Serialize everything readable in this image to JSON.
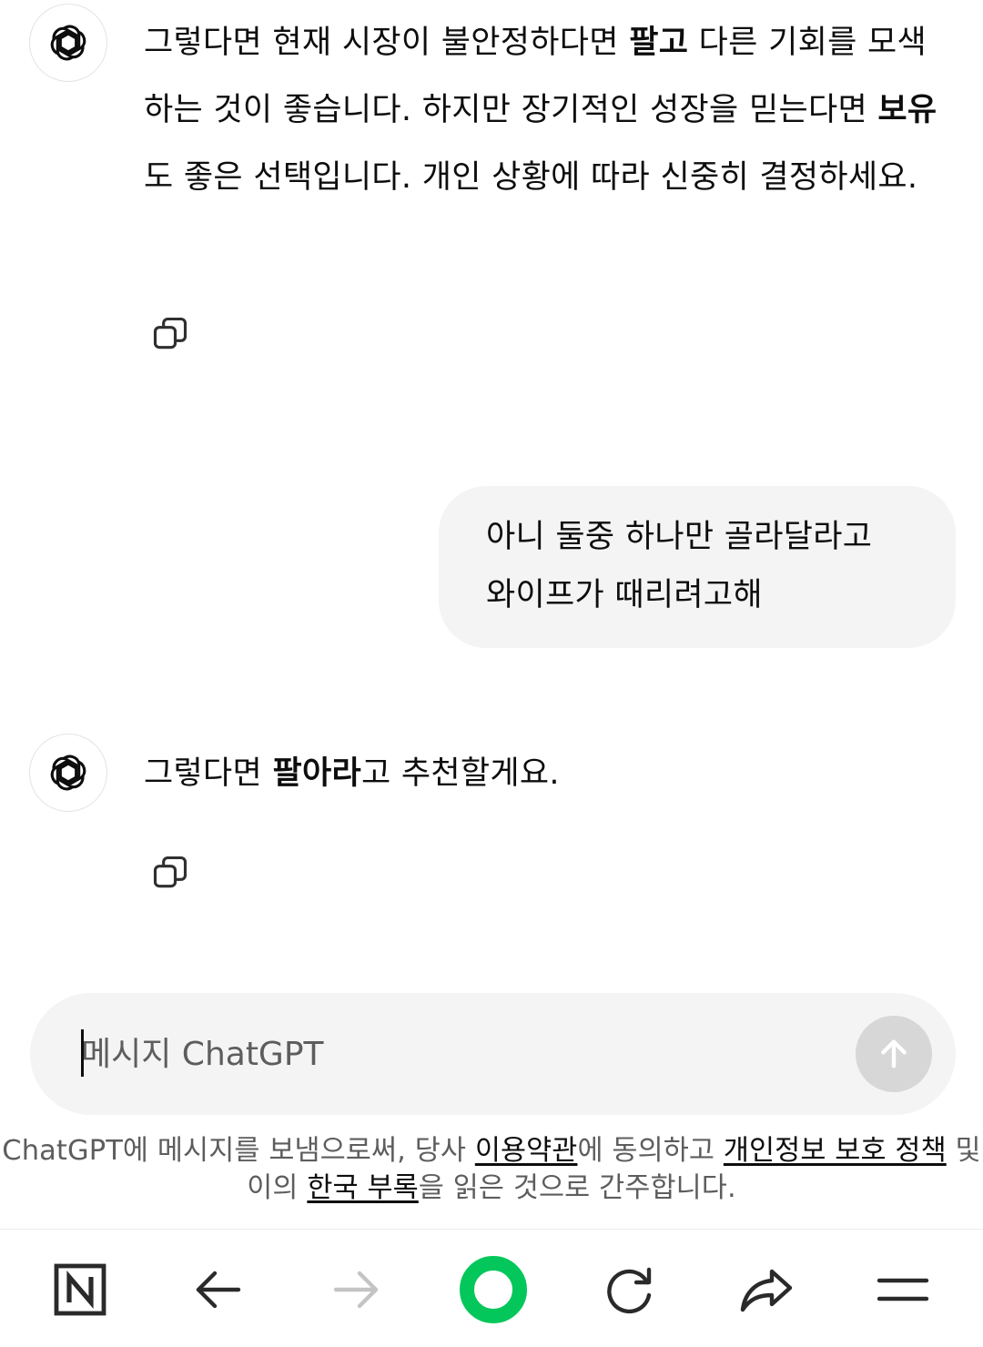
{
  "messages": {
    "assistant1": {
      "segments": [
        {
          "text": "그렇다면 현재 시장이 불안정하다면 ",
          "bold": false
        },
        {
          "text": "팔고",
          "bold": true
        },
        {
          "text": " 다른 기회를 모색하는 것이 좋습니다. 하지만 장기적인 성장을 믿는다면 ",
          "bold": false
        },
        {
          "text": "보유",
          "bold": true
        },
        {
          "text": "도 좋은 선택입니다. 개인 상황에 따라 신중히 결정하세요.",
          "bold": false
        }
      ]
    },
    "user1": {
      "line1": "아니 둘중 하나만 골라달라고",
      "line2": "와이프가 때리려고해"
    },
    "assistant2": {
      "segments": [
        {
          "text": "그렇다면 ",
          "bold": false
        },
        {
          "text": "팔아라",
          "bold": true
        },
        {
          "text": "고 추천할게요.",
          "bold": false
        }
      ]
    }
  },
  "composer": {
    "placeholder": "메시지 ChatGPT",
    "value": ""
  },
  "disclaimer": {
    "part1": "ChatGPT에 메시지를 보냄으로써, 당사 ",
    "terms_link": "이용약관",
    "part2": "에 동의하고 ",
    "privacy_link": "개인정보 보호 정책",
    "part3": " 및 이의 ",
    "korea_link": "한국 부록",
    "part4": "을 읽은 것으로 간주합니다."
  },
  "icons": {
    "avatar": "openai-logo-icon",
    "copy": "copy-icon",
    "send": "arrow-up-icon",
    "browser_home": "naver-n-icon",
    "back": "arrow-left-icon",
    "forward": "arrow-right-icon",
    "home": "green-circle-icon",
    "reload": "reload-icon",
    "share": "share-icon",
    "menu": "menu-icon"
  },
  "colors": {
    "user_bubble": "#f4f4f4",
    "composer_bg": "#f4f4f4",
    "send_disabled": "#d7d7d7",
    "browser_accent": "#03c75a"
  }
}
